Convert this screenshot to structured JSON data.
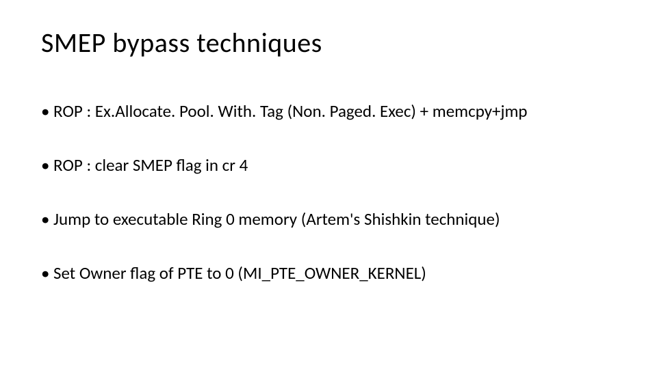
{
  "slide": {
    "title": "SMEP bypass techniques",
    "bullets": [
      "ROP : Ex.Allocate. Pool. With. Tag (Non. Paged. Exec) + memcpy+jmp",
      "ROP : clear SMEP flag in cr 4",
      "Jump to executable Ring 0 memory (Artem's Shishkin technique)",
      "Set Owner flag of PTE to 0 (MI_PTE_OWNER_KERNEL)"
    ]
  }
}
